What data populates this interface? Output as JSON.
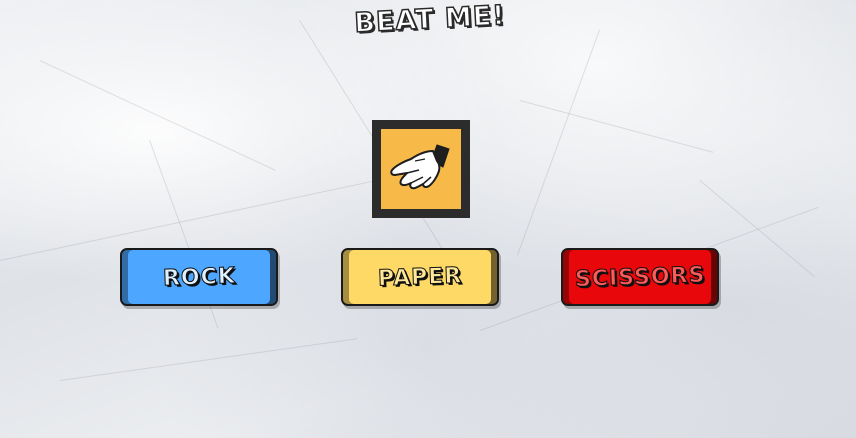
{
  "title": "BEAT ME!",
  "current_choice": {
    "icon": "paper-hand-icon"
  },
  "buttons": {
    "rock": "ROCK",
    "paper": "PAPER",
    "scissors": "SCISSORS"
  },
  "colors": {
    "rock": "#4da6ff",
    "paper": "#ffd966",
    "scissors": "#e8070a",
    "choice_frame": "#2c2c2c",
    "choice_bg": "#f7b948"
  }
}
